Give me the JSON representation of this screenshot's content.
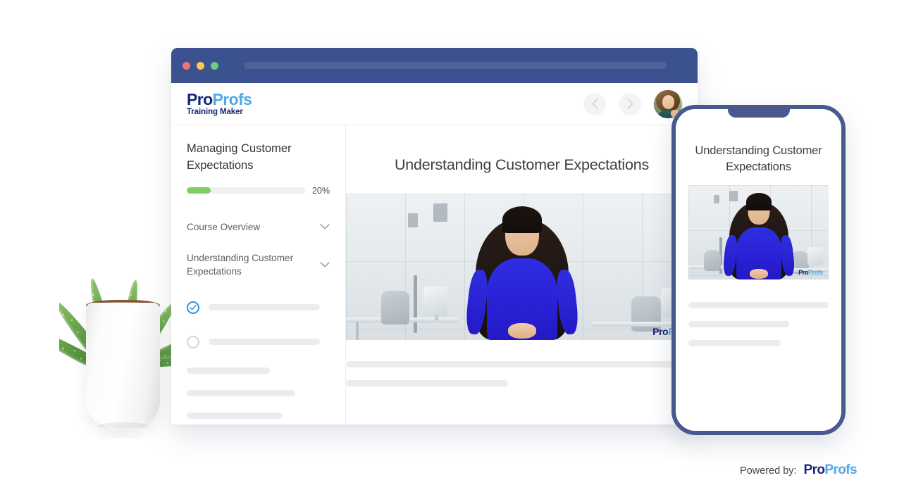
{
  "brand": {
    "logo_pro": "Pro",
    "logo_profs": "Profs",
    "logo_tagline": "Training Maker",
    "accent_blue": "#4ea8ea",
    "accent_navy": "#15277a",
    "chrome_navy": "#3c5290",
    "phone_bezel": "#485a8d",
    "progress_green": "#80ce63",
    "check_blue": "#3a8fd4",
    "skeleton_gray": "#ececec"
  },
  "browser": {
    "traffic_lights": [
      "close-red",
      "minimize-yellow",
      "maximize-green"
    ],
    "url_value": "",
    "url_placeholder": ""
  },
  "header": {
    "nav_prev_icon": "chevron-left-icon",
    "nav_next_icon": "chevron-right-icon",
    "avatar_name": "user-avatar"
  },
  "sidebar": {
    "course_title": "Managing Customer Expectations",
    "progress_percent": 20,
    "progress_label": "20%",
    "sections": [
      {
        "label": "Course Overview",
        "expand_icon": "chevron-down-icon",
        "expanded": false
      },
      {
        "label": "Understanding Customer Expectations",
        "expand_icon": "chevron-down-icon",
        "expanded": true
      }
    ],
    "lessons": [
      {
        "status": "completed",
        "status_icon": "check-circle-icon",
        "label_placeholder_width": "78%"
      },
      {
        "status": "incomplete",
        "status_icon": "circle-icon",
        "label_placeholder_width": "78%"
      }
    ],
    "skeleton_bars": [
      "58%",
      "76%",
      "67%"
    ]
  },
  "main": {
    "lesson_title": "Understanding Customer Expectations",
    "media": {
      "type": "video-frame",
      "description": "presenter in blue dress in modern office",
      "watermark_pro": "Pro",
      "watermark_profs": "Profs"
    },
    "skeleton_bars": [
      "100%",
      "46%"
    ]
  },
  "phone": {
    "notch": "phone-notch",
    "lesson_title": "Understanding Customer Expectations",
    "media": {
      "type": "video-frame",
      "description": "presenter in blue dress in modern office",
      "watermark_pro": "Pro",
      "watermark_profs": "Profs"
    },
    "skeleton_bars": [
      "100%",
      "72%",
      "66%"
    ]
  },
  "footer": {
    "powered_by": "Powered by:",
    "logo_pro": "Pro",
    "logo_profs": "Profs"
  }
}
